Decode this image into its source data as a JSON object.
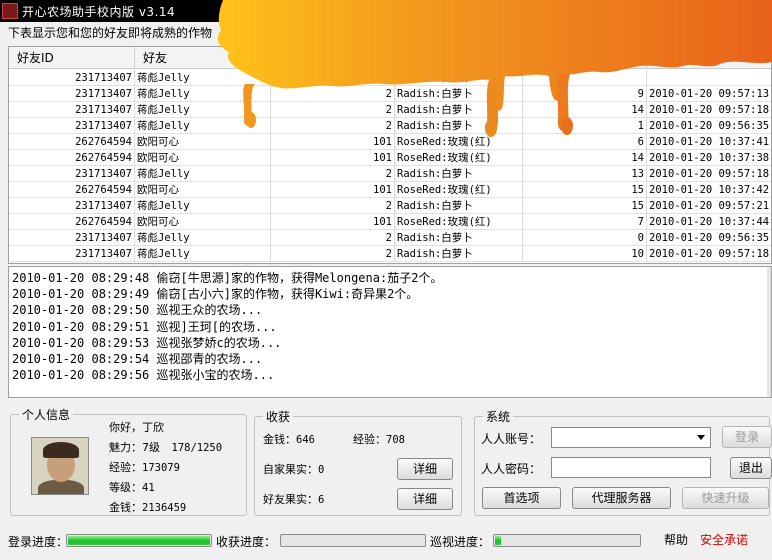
{
  "window": {
    "title": "开心农场助手校内版 v3.14"
  },
  "subtitle": "下表显示您和您的好友即将成熟的作物",
  "grid": {
    "columns": [
      "好友ID",
      "好友",
      "",
      "",
      "",
      ""
    ],
    "rows": [
      [
        "231713407",
        "蒋彪Jelly",
        "2",
        "Radish:白萝卜",
        "",
        ""
      ],
      [
        "231713407",
        "蒋彪Jelly",
        "2",
        "Radish:白萝卜",
        "9",
        "2010-01-20 09:57:13"
      ],
      [
        "231713407",
        "蒋彪Jelly",
        "2",
        "Radish:白萝卜",
        "14",
        "2010-01-20 09:57:18"
      ],
      [
        "231713407",
        "蒋彪Jelly",
        "2",
        "Radish:白萝卜",
        "1",
        "2010-01-20 09:56:35"
      ],
      [
        "262764594",
        "欧阳可心",
        "101",
        "RoseRed:玫瑰(红)",
        "6",
        "2010-01-20 10:37:41"
      ],
      [
        "262764594",
        "欧阳可心",
        "101",
        "RoseRed:玫瑰(红)",
        "14",
        "2010-01-20 10:37:38"
      ],
      [
        "231713407",
        "蒋彪Jelly",
        "2",
        "Radish:白萝卜",
        "13",
        "2010-01-20 09:57:18"
      ],
      [
        "262764594",
        "欧阳可心",
        "101",
        "RoseRed:玫瑰(红)",
        "15",
        "2010-01-20 10:37:42"
      ],
      [
        "231713407",
        "蒋彪Jelly",
        "2",
        "Radish:白萝卜",
        "15",
        "2010-01-20 09:57:21"
      ],
      [
        "262764594",
        "欧阳可心",
        "101",
        "RoseRed:玫瑰(红)",
        "7",
        "2010-01-20 10:37:44"
      ],
      [
        "231713407",
        "蒋彪Jelly",
        "2",
        "Radish:白萝卜",
        "0",
        "2010-01-20 09:56:35"
      ],
      [
        "231713407",
        "蒋彪Jelly",
        "2",
        "Radish:白萝卜",
        "10",
        "2010-01-20 09:57:18"
      ]
    ]
  },
  "log": [
    "2010-01-20 08:29:48 偷窃[牛思源]家的作物，获得Melongena:茄子2个。",
    "2010-01-20 08:29:49 偷窃[古小六]家的作物，获得Kiwi:奇异果2个。",
    "2010-01-20 08:29:50 巡视王众的农场...",
    "2010-01-20 08:29:51 巡视]王珂[的农场...",
    "2010-01-20 08:29:53 巡视张梦娇c的农场...",
    "2010-01-20 08:29:54 巡视邵青的农场...",
    "2010-01-20 08:29:56 巡视张小宝的农场..."
  ],
  "personal": {
    "group_title": "个人信息",
    "greeting": "你好，丁欣",
    "charm_label": "魅力：",
    "charm_rank": "7级",
    "charm_progress": "178/1250",
    "exp_label": "经验：",
    "exp_value": "173079",
    "level_label": "等级：",
    "level_value": "41",
    "money_label": "金钱：",
    "money_value": "2136459"
  },
  "harvest": {
    "group_title": "收获",
    "money_label": "金钱：",
    "money_value": "646",
    "exp_label": "经验：",
    "exp_value": "708",
    "own_label": "自家果实：",
    "own_value": "0",
    "friend_label": "好友果实：",
    "friend_value": "6",
    "detail_button": "详细"
  },
  "system": {
    "group_title": "系统",
    "account_label": "人人账号：",
    "account_value": "",
    "password_label": "人人密码：",
    "password_value": "",
    "login_button": "登录",
    "exit_button": "退出",
    "prefs_button": "首选项",
    "proxy_button": "代理服务器",
    "upgrade_button": "快速升级"
  },
  "status": {
    "login_label": "登录进度：",
    "login_progress": 1.0,
    "harvest_label": "收获进度：",
    "harvest_progress": 0.0,
    "patrol_label": "巡视进度：",
    "patrol_progress": 0.04,
    "help_link": "帮助",
    "promise_link": "安全承诺",
    "promise_color": "#d40000"
  },
  "colors": {
    "flame_orange": "#f07a1c",
    "flame_yellow": "#ffc21a",
    "progress_green": "#1dbb2b"
  }
}
